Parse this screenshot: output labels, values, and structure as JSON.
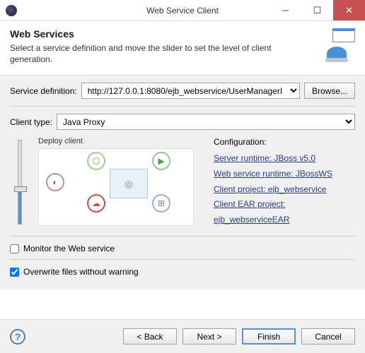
{
  "window": {
    "title": "Web Service Client"
  },
  "header": {
    "title": "Web Services",
    "subtitle": "Select a service definition and move the slider to set the level of client generation."
  },
  "serviceDef": {
    "label": "Service definition:",
    "value": "http://127.0.0.1:8080/ejb_webservice/UserManagerI",
    "browse": "Browse..."
  },
  "clientType": {
    "label": "Client type:",
    "value": "Java Proxy"
  },
  "diagram": {
    "label": "Deploy client"
  },
  "config": {
    "title": "Configuration:",
    "links": [
      "Server runtime: JBoss v5.0",
      "Web service runtime: JBossWS",
      "Client project: ejb_webservice",
      "Client EAR project: ejb_webserviceEAR"
    ]
  },
  "checkboxes": {
    "monitor": "Monitor the Web service",
    "overwrite": "Overwrite files without warning"
  },
  "buttons": {
    "back": "< Back",
    "next": "Next >",
    "finish": "Finish",
    "cancel": "Cancel"
  }
}
